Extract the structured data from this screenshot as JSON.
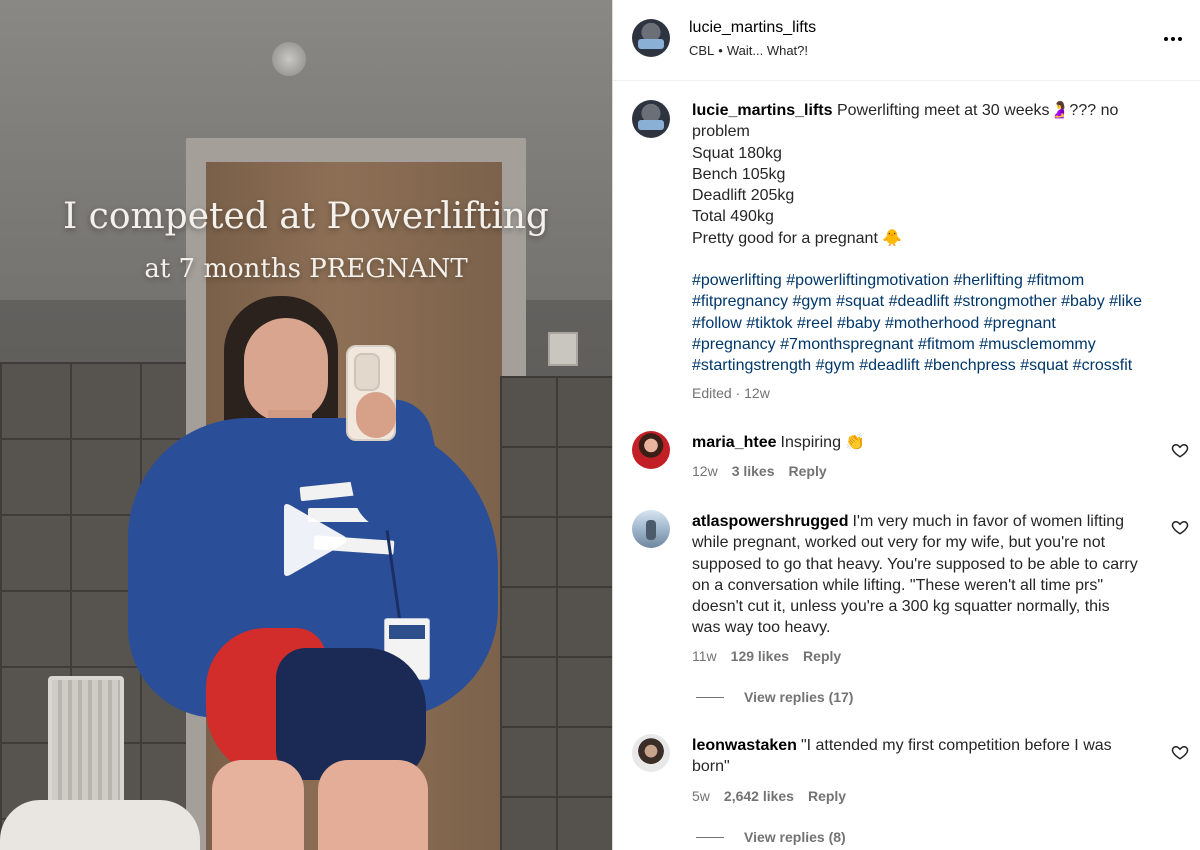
{
  "video": {
    "title_line1": "I competed at Powerlifting",
    "title_line2": "at 7 months PREGNANT",
    "play_icon": "play-icon"
  },
  "post": {
    "username": "lucie_martins_lifts",
    "audio_artist": "CBL",
    "separator": "•",
    "audio_title": "Wait... What?!",
    "more_icon": "more-horizontal-icon"
  },
  "caption": {
    "username": "lucie_martins_lifts",
    "text_line1": "Powerlifting meet at 30 weeks🤰??? no",
    "text_line2": "problem",
    "squat": "Squat 180kg",
    "bench": "Bench 105kg",
    "deadlift": "Deadlift 205kg",
    "total": "Total 490kg",
    "closing": "Pretty good for a pregnant 🐥",
    "hashtags": [
      "#powerlifting #powerliftingmotivation #herlifting #fitmom",
      "#fitpregnancy #gym #squat #deadlift #strongmother #baby #like",
      "#follow #tiktok #reel #baby #motherhood #pregnant",
      "#pregnancy #7monthspregnant #fitmom #musclemommy",
      "#startingstrength #gym #deadlift #benchpress #squat #crossfit"
    ],
    "edited": "Edited · 12w"
  },
  "comments": [
    {
      "username": "maria_htee",
      "text": "Inspiring 👏",
      "time": "12w",
      "likes": "3 likes",
      "reply": "Reply"
    },
    {
      "username": "atlaspowershrugged",
      "text": "I'm very much in favor of women lifting while pregnant, worked out very for my wife, but you're not supposed to go that heavy. You're supposed to be able to carry on a conversation while lifting. \"These weren't all time prs\" doesn't cut it, unless you're a 300 kg squatter normally, this was way too heavy.",
      "time": "11w",
      "likes": "129 likes",
      "reply": "Reply",
      "view_replies": "View replies (17)"
    },
    {
      "username": "leonwastaken",
      "text": "\"I attended my first competition before I was born\"",
      "time": "5w",
      "likes": "2,642 likes",
      "reply": "Reply",
      "view_replies": "View replies (8)"
    }
  ]
}
